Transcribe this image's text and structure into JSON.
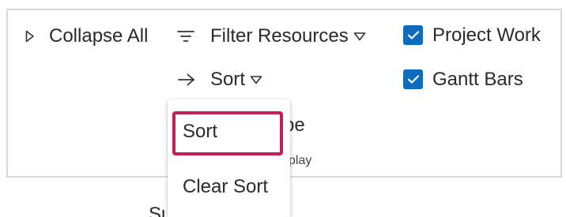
{
  "ribbon": {
    "collapse_all_label": "Collapse All",
    "filter_resources_label": "Filter Resources",
    "sort_label": "Sort",
    "project_work_label": "Project Work",
    "gantt_bars_label": "Gantt Bars",
    "project_work_checked": true,
    "gantt_bars_checked": true,
    "obscured_fragment": "pe",
    "group_label_fragment": "play",
    "bottom_fragment": "Su"
  },
  "sort_menu": {
    "items": [
      {
        "label": "Sort"
      },
      {
        "label": "Clear Sort"
      }
    ],
    "highlighted_item": "Sort"
  },
  "icons": {
    "collapse": "triangle-right-icon",
    "filter": "filter-lines-icon",
    "sort": "arrow-right-icon",
    "caret": "triangle-down-outline-icon",
    "check": "checkmark-icon"
  },
  "colors": {
    "checkbox_fill": "#0f6cbd",
    "highlight_border": "#c31d5c",
    "panel_border": "#d8d8d8"
  }
}
